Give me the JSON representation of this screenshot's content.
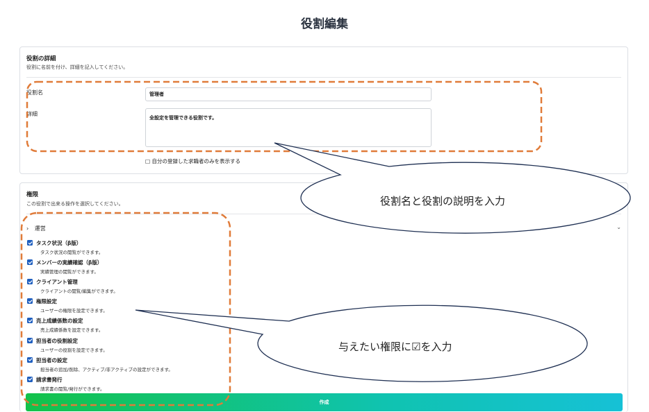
{
  "page": {
    "title": "役割編集"
  },
  "details": {
    "title": "役割の詳細",
    "subtitle": "役割に名前を付け、詳細を記入してください。",
    "name_label": "役割名",
    "name_value": "管理者",
    "desc_label": "詳細",
    "desc_value": "全設定を管理できる役割です。",
    "only_mine_checkbox": "□",
    "only_mine_label": "自分の登録した求職者のみを表示する"
  },
  "permissions": {
    "title": "権限",
    "subtitle": "この役割で出来る操作を選択してください。",
    "section_arrow": "›",
    "section_label": "運営",
    "chevron": "⌄",
    "checked_color": "#1f5fbf",
    "items": [
      {
        "name": "タスク状況（β版）",
        "desc": "タスク状況の閲覧ができます。",
        "checked": true
      },
      {
        "name": "メンバーの実績確認（β版）",
        "desc": "実績管理の閲覧ができます。",
        "checked": true
      },
      {
        "name": "クライアント管理",
        "desc": "クライアントの閲覧/編集ができます。",
        "checked": true
      },
      {
        "name": "権限設定",
        "desc": "ユーザーの権限を設定できます。",
        "checked": true
      },
      {
        "name": "売上成績係数の設定",
        "desc": "売上成績係数を設定できます。",
        "checked": true
      },
      {
        "name": "担当者の役割設定",
        "desc": "ユーザーの役割を設定できます。",
        "checked": true
      },
      {
        "name": "担当者の設定",
        "desc": "担当者の追加/削除、アクティブ/非アクティブの設定ができます。",
        "checked": true
      },
      {
        "name": "請求書発行",
        "desc": "請求書の閲覧/発行ができます。",
        "checked": true
      }
    ]
  },
  "actions": {
    "create_label": "作成"
  },
  "annotations": {
    "highlight_color": "#e07b39",
    "callout_name": "役割名と役割の説明を入力",
    "callout_perms": "与えたい権限に☑を入力"
  }
}
